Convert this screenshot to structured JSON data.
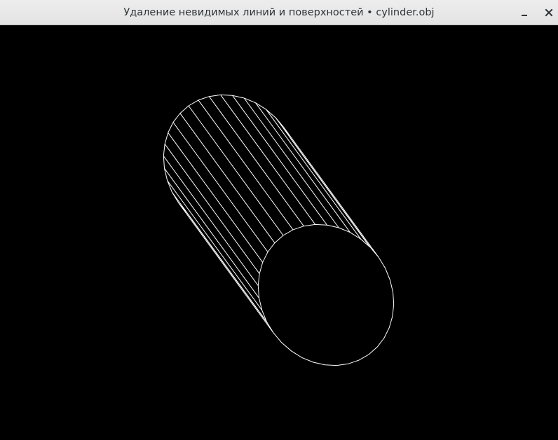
{
  "window": {
    "title": "Удаление невидимых линий и поверхностей • cylinder.obj"
  },
  "titlebar_buttons": [
    {
      "name": "minimize",
      "icon": "minimize-icon"
    },
    {
      "name": "close",
      "icon": "close-icon"
    }
  ],
  "viewport": {
    "background": "#000000",
    "line_color": "#ffffff",
    "model": {
      "segments": 36
    }
  }
}
